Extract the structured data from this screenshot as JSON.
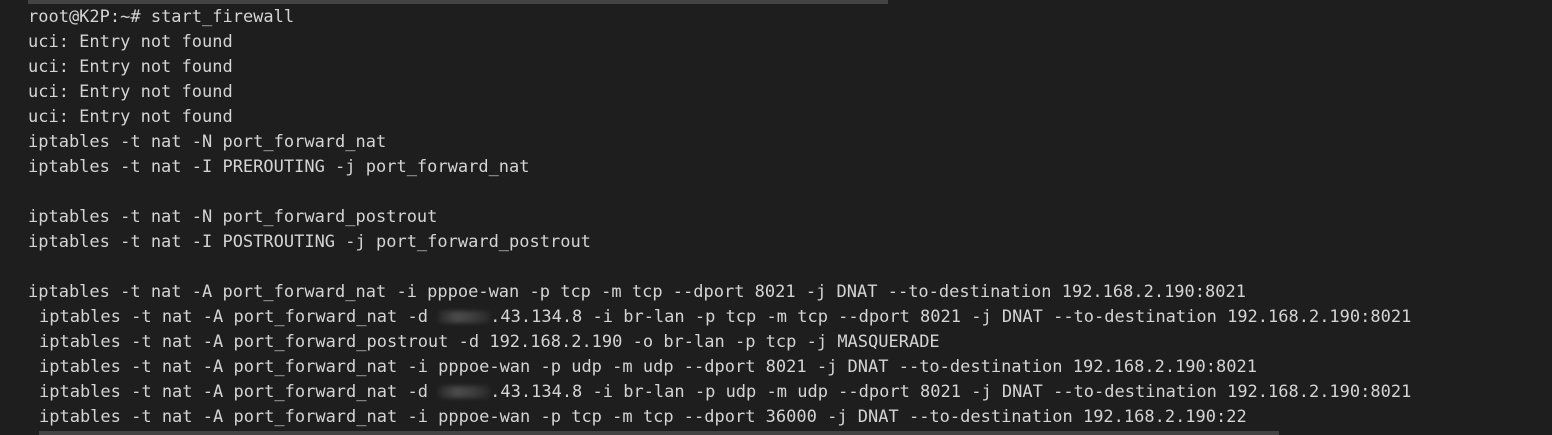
{
  "terminal": {
    "prompt": "root@K2P:~# ",
    "command": "start_firewall",
    "output": [
      "uci: Entry not found",
      "uci: Entry not found",
      "uci: Entry not found",
      "uci: Entry not found",
      "iptables -t nat -N port_forward_nat",
      "iptables -t nat -I PREROUTING -j port_forward_nat",
      "iptables -t nat -N port_forward_postrout",
      "iptables -t nat -I POSTROUTING -j port_forward_postrout",
      "iptables -t nat -A port_forward_nat -i pppoe-wan -p tcp -m tcp --dport 8021 -j DNAT --to-destination 192.168.2.190:8021"
    ],
    "rule_tcp_lan": {
      "prefix": "iptables -t nat -A port_forward_nat -d ",
      "suffix": ".43.134.8 -i br-lan -p tcp -m tcp --dport 8021 -j DNAT --to-destination 192.168.2.190:8021"
    },
    "rule_masq": "iptables -t nat -A port_forward_postrout -d 192.168.2.190 -o br-lan -p tcp -j MASQUERADE",
    "rule_udp_wan": "iptables -t nat -A port_forward_nat -i pppoe-wan -p udp -m udp --dport 8021 -j DNAT --to-destination 192.168.2.190:8021",
    "rule_udp_lan": {
      "prefix": "iptables -t nat -A port_forward_nat -d ",
      "suffix": ".43.134.8 -i br-lan -p udp -m udp --dport 8021 -j DNAT --to-destination 192.168.2.190:8021"
    },
    "rule_ssh": "iptables -t nat -A port_forward_nat -i pppoe-wan -p tcp -m tcp --dport 36000 -j DNAT --to-destination 192.168.2.190:22"
  }
}
